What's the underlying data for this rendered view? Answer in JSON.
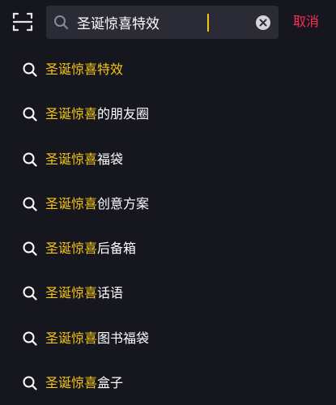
{
  "header": {
    "search_value": "圣诞惊喜特效",
    "cancel_label": "取消"
  },
  "colors": {
    "background": "#15161e",
    "search_bg": "#2a2b34",
    "highlight": "#f5c518",
    "cancel": "#ff2d55"
  },
  "suggestions": [
    {
      "highlight": "圣诞惊喜特效",
      "rest": ""
    },
    {
      "highlight": "圣诞惊喜",
      "rest": "的朋友圈"
    },
    {
      "highlight": "圣诞惊喜",
      "rest": "福袋"
    },
    {
      "highlight": "圣诞惊喜",
      "rest": "创意方案"
    },
    {
      "highlight": "圣诞惊喜",
      "rest": "后备箱"
    },
    {
      "highlight": "圣诞惊喜",
      "rest": "话语"
    },
    {
      "highlight": "圣诞惊喜",
      "rest": "图书福袋"
    },
    {
      "highlight": "圣诞惊喜",
      "rest": "盒子"
    }
  ]
}
